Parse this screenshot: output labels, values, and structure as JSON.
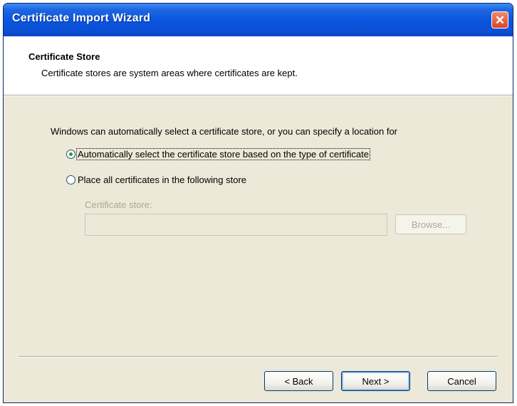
{
  "window": {
    "title": "Certificate Import Wizard",
    "close_glyph": "✕"
  },
  "header": {
    "title": "Certificate Store",
    "description": "Certificate stores are system areas where certificates are kept."
  },
  "body": {
    "intro": "Windows can automatically select a certificate store, or you can specify a location for",
    "options": [
      {
        "label": "Automatically select the certificate store based on the type of certificate",
        "selected": true
      },
      {
        "label": "Place all certificates in the following store",
        "selected": false
      }
    ],
    "store_label": "Certificate store:",
    "store_value": "",
    "browse_label": "Browse..."
  },
  "buttons": {
    "back": "< Back",
    "next": "Next >",
    "cancel": "Cancel"
  },
  "colors": {
    "titlebar": "#0a56e0",
    "dialog_bg": "#ece9d8",
    "radio_dot": "#21a121",
    "close_button": "#d9452a"
  }
}
